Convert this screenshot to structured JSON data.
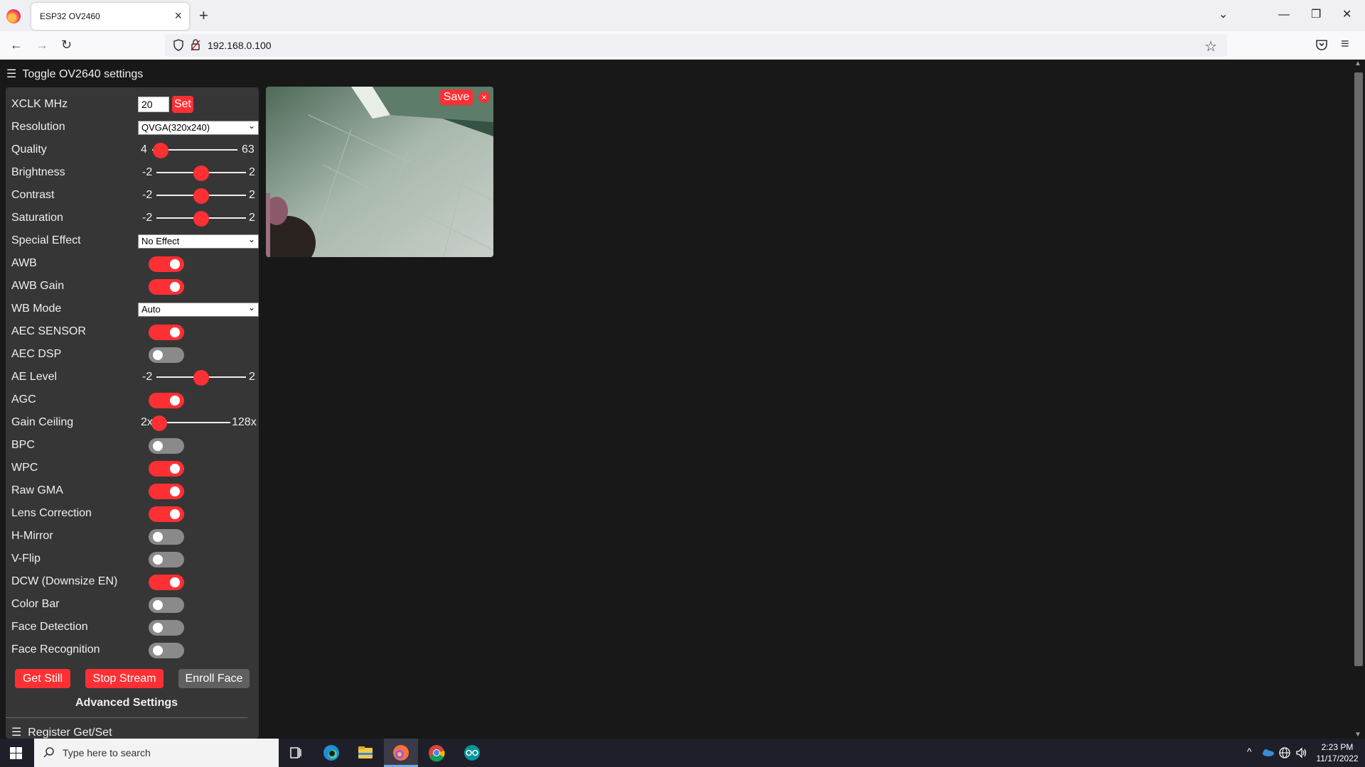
{
  "browser": {
    "tab_title": "ESP32 OV2460",
    "url": "192.168.0.100",
    "icons": [
      "firefox-icon",
      "close-icon",
      "plus-icon",
      "chevron-down-icon",
      "minimize-icon",
      "restore-icon",
      "close-window-icon",
      "back-icon",
      "forward-icon",
      "reload-icon",
      "shield-icon",
      "lock-icon",
      "star-icon",
      "pocket-icon",
      "menu-icon"
    ]
  },
  "page": {
    "toggle_settings": "Toggle OV2640 settings",
    "xclk": {
      "label": "XCLK MHz",
      "value": "20",
      "set_label": "Set"
    },
    "resolution": {
      "label": "Resolution",
      "value": "QVGA(320x240)"
    },
    "quality": {
      "label": "Quality",
      "min": "4",
      "max": "63",
      "value": 10
    },
    "brightness": {
      "label": "Brightness",
      "min": "-2",
      "max": "2",
      "value": 0
    },
    "contrast": {
      "label": "Contrast",
      "min": "-2",
      "max": "2",
      "value": 0
    },
    "saturation": {
      "label": "Saturation",
      "min": "-2",
      "max": "2",
      "value": 0
    },
    "special_effect": {
      "label": "Special Effect",
      "value": "No Effect"
    },
    "awb": {
      "label": "AWB",
      "on": true
    },
    "awb_gain": {
      "label": "AWB Gain",
      "on": true
    },
    "wb_mode": {
      "label": "WB Mode",
      "value": "Auto"
    },
    "aec_sensor": {
      "label": "AEC SENSOR",
      "on": true
    },
    "aec_dsp": {
      "label": "AEC DSP",
      "on": false
    },
    "ae_level": {
      "label": "AE Level",
      "min": "-2",
      "max": "2",
      "value": 0
    },
    "agc": {
      "label": "AGC",
      "on": true
    },
    "gain_ceiling": {
      "label": "Gain Ceiling",
      "min": "2x",
      "max": "128x",
      "value": 0
    },
    "bpc": {
      "label": "BPC",
      "on": false
    },
    "wpc": {
      "label": "WPC",
      "on": true
    },
    "raw_gma": {
      "label": "Raw GMA",
      "on": true
    },
    "lens_correction": {
      "label": "Lens Correction",
      "on": true
    },
    "h_mirror": {
      "label": "H-Mirror",
      "on": false
    },
    "v_flip": {
      "label": "V-Flip",
      "on": false
    },
    "dcw": {
      "label": "DCW (Downsize EN)",
      "on": true
    },
    "color_bar": {
      "label": "Color Bar",
      "on": false
    },
    "face_detection": {
      "label": "Face Detection",
      "on": false
    },
    "face_recognition": {
      "label": "Face Recognition",
      "on": false
    },
    "buttons": {
      "get_still": "Get Still",
      "stop_stream": "Stop Stream",
      "enroll_face": "Enroll Face"
    },
    "advanced_settings": "Advanced Settings",
    "register_get_set": "Register Get/Set",
    "stream": {
      "save_label": "Save",
      "close_label": "×"
    }
  },
  "taskbar": {
    "search_placeholder": "Type here to search",
    "time": "2:23 PM",
    "date": "11/17/2022",
    "apps": [
      "task-view-icon",
      "edge-icon",
      "file-explorer-icon",
      "firefox-icon",
      "chrome-icon",
      "arduino-icon"
    ]
  },
  "colors": {
    "accent": "#ff3034",
    "panel": "#363636",
    "background": "#181818"
  }
}
